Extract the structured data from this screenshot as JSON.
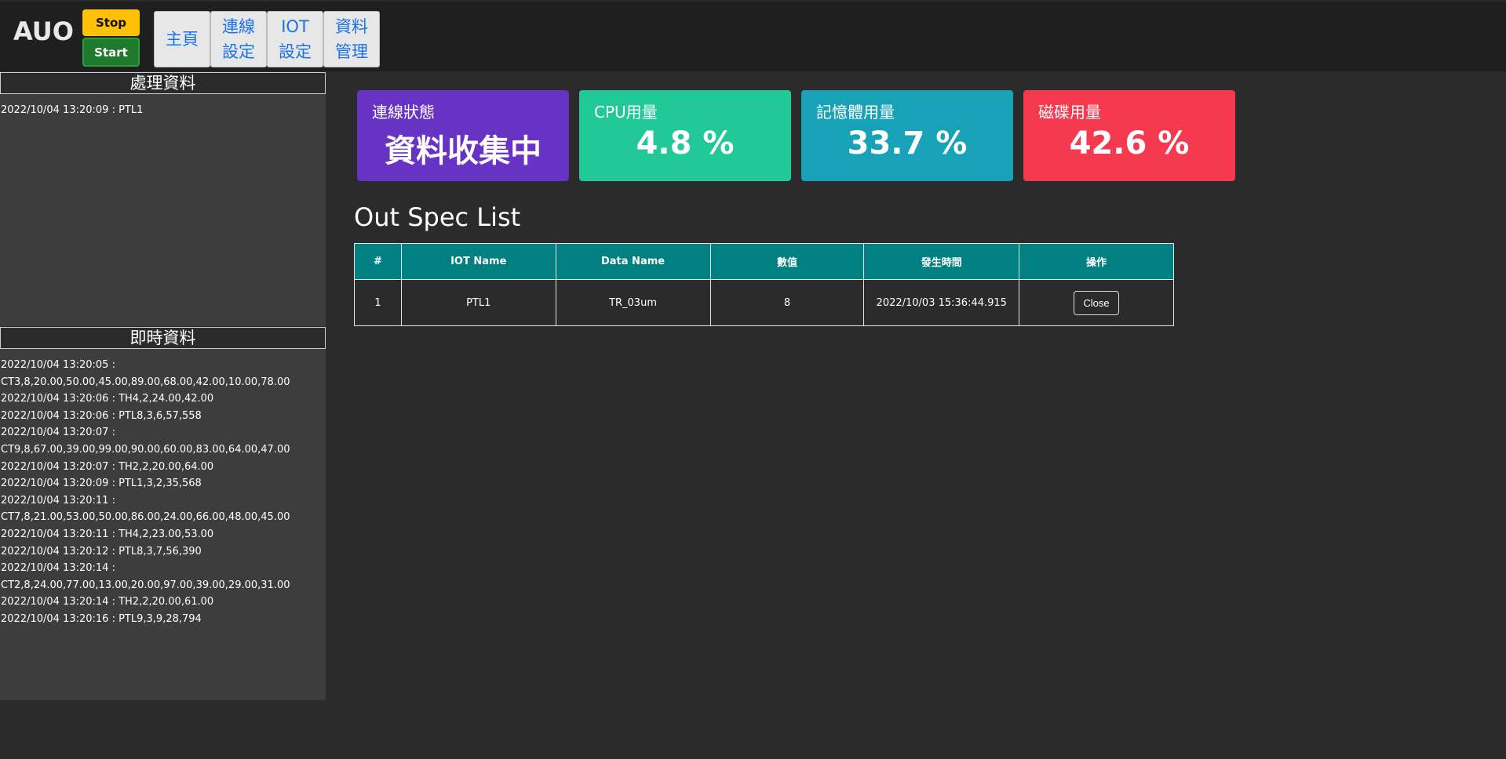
{
  "brand": "AUO",
  "controls": {
    "stop_label": "Stop",
    "start_label": "Start"
  },
  "nav": [
    {
      "label": "主頁"
    },
    {
      "label": "連線\n設定"
    },
    {
      "label": "IOT\n設定"
    },
    {
      "label": "資料\n管理"
    }
  ],
  "processing": {
    "title": "處理資料",
    "lines": [
      "2022/10/04 13:20:09 : PTL1"
    ]
  },
  "realtime": {
    "title": "即時資料",
    "lines": [
      "2022/10/04 13:20:05 :",
      "CT3,8,20.00,50.00,45.00,89.00,68.00,42.00,10.00,78.00",
      "2022/10/04 13:20:06 : TH4,2,24.00,42.00",
      "2022/10/04 13:20:06 : PTL8,3,6,57,558",
      "2022/10/04 13:20:07 :",
      "CT9,8,67.00,39.00,99.00,90.00,60.00,83.00,64.00,47.00",
      "2022/10/04 13:20:07 : TH2,2,20.00,64.00",
      "2022/10/04 13:20:09 : PTL1,3,2,35,568",
      "2022/10/04 13:20:11 :",
      "CT7,8,21.00,53.00,50.00,86.00,24.00,66.00,48.00,45.00",
      "2022/10/04 13:20:11 : TH4,2,23.00,53.00",
      "2022/10/04 13:20:12 : PTL8,3,7,56,390",
      "2022/10/04 13:20:14 :",
      "CT2,8,24.00,77.00,13.00,20.00,97.00,39.00,29.00,31.00",
      "2022/10/04 13:20:14 : TH2,2,20.00,61.00",
      "2022/10/04 13:20:16 : PTL9,3,9,28,794"
    ]
  },
  "cards": [
    {
      "label": "連線狀態",
      "value": "資料收集中",
      "color": "#6633c4"
    },
    {
      "label": "CPU用量",
      "value": "4.8 %",
      "color": "#20c997"
    },
    {
      "label": "記憶體用量",
      "value": "33.7 %",
      "color": "#17a2b8"
    },
    {
      "label": "磁碟用量",
      "value": "42.6 %",
      "color": "#f5394f"
    }
  ],
  "out_spec": {
    "title": "Out Spec List",
    "headers": [
      "#",
      "IOT Name",
      "Data Name",
      "數值",
      "發生時間",
      "操作"
    ],
    "rows": [
      {
        "index": "1",
        "iot_name": "PTL1",
        "data_name": "TR_03um",
        "value": "8",
        "time": "2022/10/03 15:36:44.915",
        "action": "Close"
      }
    ]
  }
}
